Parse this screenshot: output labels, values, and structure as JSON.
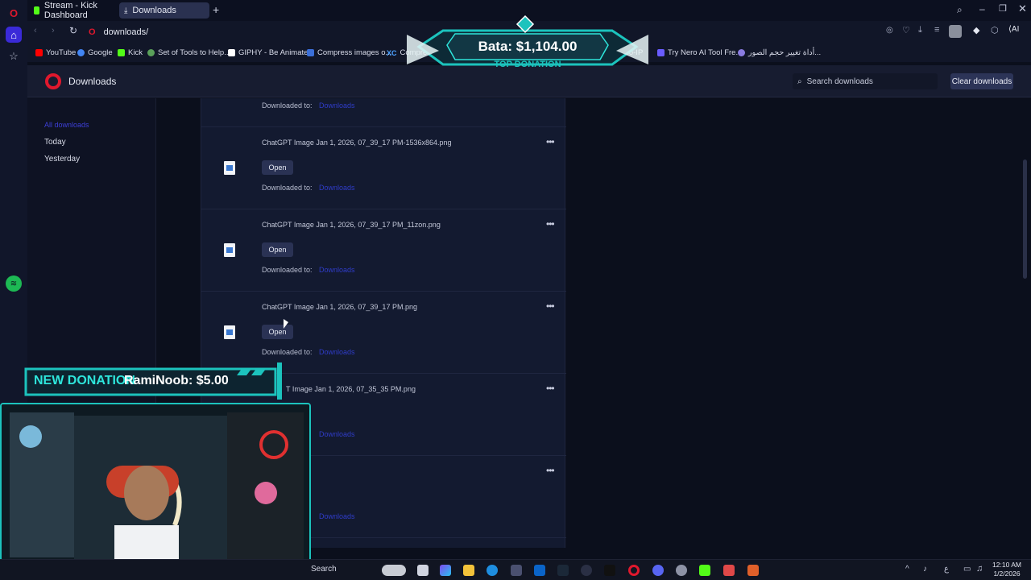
{
  "tabs": [
    {
      "label": "Stream - Kick Dashboard",
      "active": false,
      "icon_color": "#53fc18"
    },
    {
      "label": "Downloads",
      "active": true,
      "icon_color": "#c9cde0"
    }
  ],
  "address": {
    "url": "downloads/"
  },
  "bookmarks": [
    {
      "label": "YouTube",
      "color": "#ff0000"
    },
    {
      "label": "Google",
      "color": "#4285f4"
    },
    {
      "label": "Kick",
      "color": "#53fc18"
    },
    {
      "label": "Set of Tools to Help...",
      "color": "#5aa05a"
    },
    {
      "label": "GIPHY - Be Animated",
      "color": "#ffffff"
    },
    {
      "label": "Compress images o...",
      "color": "#3b6fd8"
    },
    {
      "label": "Compress",
      "color": "#4aa0ff"
    },
    {
      "label": "No-IP",
      "color": "#2a7be4"
    },
    {
      "label": "Try Nero AI Tool Fre...",
      "color": "#6a5cff"
    },
    {
      "label": "أداة تغيير حجم الصور...",
      "color": "#8a7ce0"
    }
  ],
  "header": {
    "title": "Downloads",
    "search_placeholder": "Search downloads",
    "clear_label": "Clear downloads"
  },
  "nav": {
    "items": [
      {
        "label": "All downloads",
        "active": true
      },
      {
        "label": "Today",
        "active": false
      },
      {
        "label": "Yesterday",
        "active": false
      }
    ]
  },
  "downloads": {
    "partial_top": {
      "downloaded_to": "Downloaded to:",
      "path": "Downloads"
    },
    "items": [
      {
        "name": "ChatGPT Image Jan 1, 2026, 07_39_17 PM-1536x864.png",
        "open_label": "Open",
        "downloaded_to": "Downloaded to:",
        "path": "Downloads"
      },
      {
        "name": "ChatGPT Image Jan 1, 2026, 07_39_17 PM_11zon.png",
        "open_label": "Open",
        "downloaded_to": "Downloaded to:",
        "path": "Downloads"
      },
      {
        "name": "ChatGPT Image Jan 1, 2026, 07_39_17 PM.png",
        "open_label": "Open",
        "downloaded_to": "Downloaded to:",
        "path": "Downloads"
      },
      {
        "name": "T Image Jan 1, 2026, 07_35_35 PM.png",
        "open_label": "",
        "downloaded_to": ":",
        "path": "Downloads"
      },
      {
        "name": "",
        "open_label": "",
        "downloaded_to": "",
        "path": "Downloads"
      }
    ]
  },
  "overlays": {
    "top_donation_text": "Bata: $1,104.00",
    "top_donation_label": "TOP DONATION",
    "new_donation_label": "NEW DONATION",
    "new_donation_text": "RamiNoob: $5.00"
  },
  "taskbar": {
    "search_label": "Search",
    "time": "12:10 AM",
    "date": "1/2/2026",
    "lang": "ع"
  },
  "colors": {
    "accent_cyan": "#1cc3bd",
    "opera_red": "#e0182d",
    "link_blue": "#2f3cc8"
  }
}
